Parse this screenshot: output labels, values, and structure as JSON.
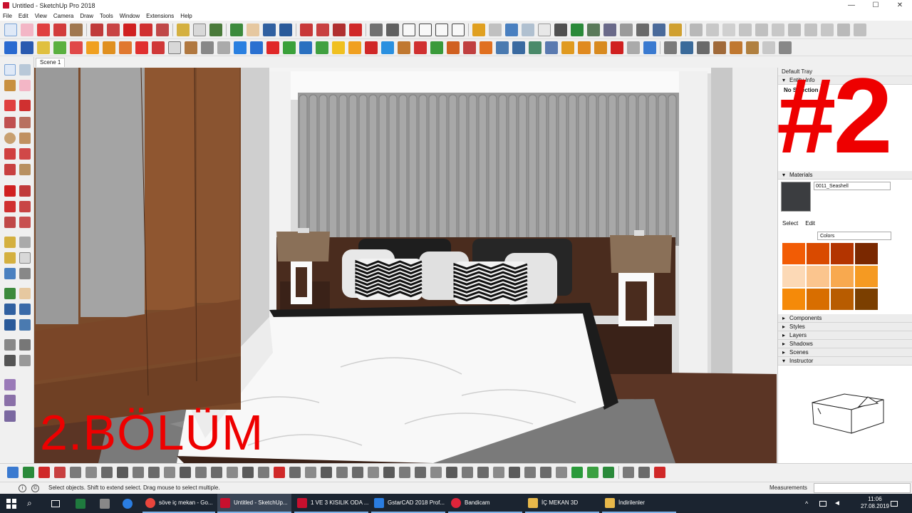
{
  "window": {
    "title": "Untitled - SketchUp Pro 2018",
    "controls": [
      "—",
      "☐",
      "✕"
    ]
  },
  "menu": [
    "File",
    "Edit",
    "View",
    "Camera",
    "Draw",
    "Tools",
    "Window",
    "Extensions",
    "Help"
  ],
  "scene_tab": "Scene 1",
  "overlay": {
    "episode_text": "2.BÖLÜM",
    "episode_number": "#2"
  },
  "tray": {
    "title": "Default Tray",
    "entity_info": {
      "label": "Entity Info",
      "selection": "No Selection"
    },
    "materials": {
      "label": "Materials",
      "name": "0011_Seashell",
      "swatch_color": "#3b3d40",
      "tabs": [
        "Select",
        "Edit"
      ],
      "library": "Colors",
      "colors": [
        "#f25c05",
        "#d94a00",
        "#b33400",
        "#7a2800",
        "#fcd9b6",
        "#fbc58e",
        "#f8a94f",
        "#f59a22",
        "#f58a09",
        "#d86e00",
        "#b85c00",
        "#7b3f00"
      ]
    },
    "collapsed_panels": [
      "Components",
      "Styles",
      "Layers",
      "Shadows",
      "Scenes"
    ],
    "instructor": {
      "label": "Instructor"
    }
  },
  "status": {
    "text": "Select objects. Shift to extend select. Drag mouse to select multiple.",
    "measurements_label": "Measurements"
  },
  "taskbar": {
    "items": [
      {
        "label": "söve iç mekan - Go...",
        "color": "#e8453c"
      },
      {
        "label": "Untitled - SketchUp...",
        "color": "#c8102e"
      },
      {
        "label": "1 VE 3  KISILIK ODA ...",
        "color": "#c8102e"
      },
      {
        "label": "GstarCAD 2018 Prof...",
        "color": "#2a7de1"
      },
      {
        "label": "Bandicam",
        "color": "#e0243a"
      },
      {
        "label": "İÇ MEKAN 3D",
        "color": "#e8b84a"
      },
      {
        "label": "İndirilenler",
        "color": "#e8b84a"
      }
    ],
    "time": "11:06",
    "date": "27.08.2019"
  }
}
